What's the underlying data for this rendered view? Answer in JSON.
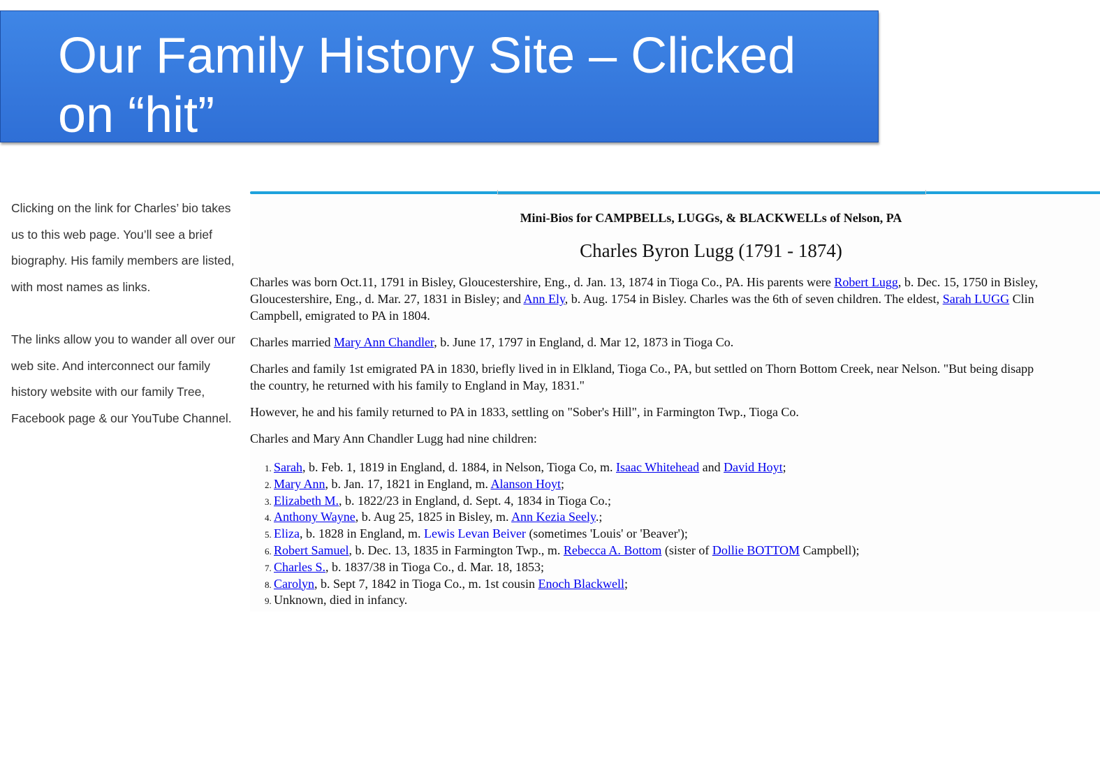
{
  "slide": {
    "title": "Our Family History Site – Clicked on “hit”",
    "notes": [
      "Clicking on the link for Charles’ bio takes us to this web page. You’ll see a brief biography. His family members are listed, with most names as links.",
      "The links allow you to wander all over our web site. And interconnect our family history website with our family Tree, Facebook page & our YouTube Channel."
    ]
  },
  "webpage": {
    "site_header": "Mini-Bios for CAMPBELLs, LUGGs, & BLACKWELLs of Nelson, PA",
    "bio_title": "Charles Byron Lugg (1791 - 1874)",
    "p1": {
      "t1": "Charles was born Oct.11, 1791 in Bisley, Gloucestershire, Eng., d. Jan. 13, 1874 in Tioga Co., PA. His parents were ",
      "link_father": "Robert Lugg",
      "t2": ", b. Dec. 15, 1750 in Bisley,",
      "t3": "Gloucestershire, Eng., d. Mar. 27, 1831 in Bisley; and ",
      "link_mother": "Ann Ely",
      "t4": ", b. Aug. 1754 in Bisley. Charles was the 6th of seven children. The eldest, ",
      "link_eldest": "Sarah LUGG",
      "t5": " Clin",
      "t6": "Campbell, emigrated to PA in 1804."
    },
    "p2": {
      "t1": "Charles married ",
      "link_wife": "Mary Ann Chandler",
      "t2": ", b. June 17, 1797 in England, d. Mar 12, 1873 in Tioga Co."
    },
    "p3": {
      "line1": "Charles and family 1st emigrated PA in 1830, briefly lived in in Elkland, Tioga Co., PA, but settled on Thorn Bottom Creek, near Nelson. \"But being disapp",
      "line2": "the country, he returned with his family to England in May, 1831.\""
    },
    "p4": "However, he and his family returned to PA in 1833, settling on \"Sober's Hill\", in Farmington Twp., Tioga Co.",
    "p5": "Charles and Mary Ann Chandler Lugg had nine children:",
    "children": [
      {
        "name": "Sarah",
        "t1": ", b. Feb. 1, 1819 in England, d. 1884, in Nelson, Tioga Co, m. ",
        "s1": "Isaac Whitehead",
        "t2": " and ",
        "s2": "David Hoyt",
        "t3": ";"
      },
      {
        "name": "Mary Ann",
        "t1": ", b. Jan. 17, 1821 in England, m. ",
        "s1": "Alanson Hoyt",
        "t2": ";"
      },
      {
        "name": "Elizabeth M.",
        "t1": ", b. 1822/23 in England, d. Sept. 4, 1834 in Tioga Co.;"
      },
      {
        "name": "Anthony Wayne",
        "t1": ", b. Aug 25, 1825 in Bisley, m. ",
        "s1": "Ann Kezia Seely",
        "t2": ".;"
      },
      {
        "name": "Eliza",
        "t1": ", b. 1828 in England, m. ",
        "s1": "Lewis Levan Beiver",
        "t2": " (sometimes 'Louis' or 'Beaver');"
      },
      {
        "name": "Robert Samuel",
        "t1": ", b. Dec. 13, 1835 in Farmington Twp., m. ",
        "s1": "Rebecca A. Bottom",
        "t2": " (sister of ",
        "s2": "Dollie BOTTOM",
        "t3": " Campbell);"
      },
      {
        "name": "Charles S.",
        "t1": ", b. 1837/38 in Tioga Co., d. Mar. 18, 1853;"
      },
      {
        "name": "Carolyn",
        "t1": ", b. Sept 7, 1842 in Tioga Co., m. 1st cousin ",
        "s1": "Enoch Blackwell",
        "t2": ";"
      },
      {
        "t1": "Unknown, died in infancy."
      }
    ]
  },
  "colors": {
    "banner": "#3479e0",
    "link": "#0000ee",
    "accent_rule": "#1ea2dc"
  }
}
